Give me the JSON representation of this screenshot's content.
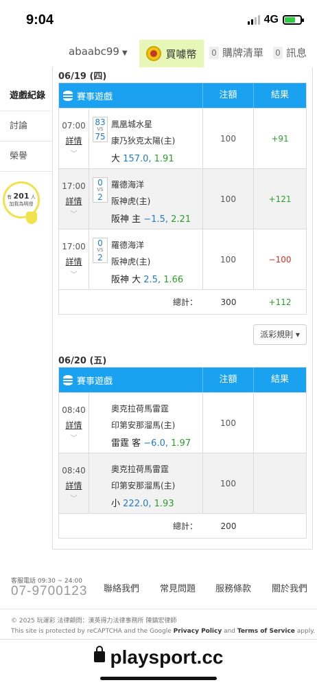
{
  "status_bar": {
    "time": "9:04",
    "network": "4G"
  },
  "nav": {
    "username": "abaabc99",
    "buy_coin": "買噱幣",
    "cart_count": "0",
    "cart_label": "購牌清單",
    "msg_count": "0",
    "msg_label": "訊息"
  },
  "sidebar": {
    "items": [
      {
        "label": "遊戲紀錄"
      },
      {
        "label": "討論"
      },
      {
        "label": "榮譽"
      }
    ],
    "help": {
      "prefix": "有",
      "count": "201",
      "suffix": "人",
      "caption": "加我為明燈"
    }
  },
  "headers": {
    "game": "賽事遊戲",
    "bet": "注額",
    "result": "結果"
  },
  "day1": {
    "date": "06/19 (四)",
    "rows": [
      {
        "time": "07:00",
        "detail": "詳情",
        "score_away": "83",
        "vs": "VS",
        "score_home": "75",
        "away": "鳳凰城水星",
        "home": "康乃狄克太陽(主)",
        "pick_text": "大",
        "pick_line": "157.0",
        "pick_sep": ",",
        "pick_odds": "1.91",
        "bet": "100",
        "result": "+91",
        "result_type": "win"
      },
      {
        "time": "17:00",
        "detail": "詳情",
        "score_away": "0",
        "vs": "VS",
        "score_home": "2",
        "away": "羅德海洋",
        "home": "阪神虎(主)",
        "pick_text": "阪神 主",
        "pick_line": "−1.5",
        "pick_sep": ",",
        "pick_odds": "2.21",
        "bet": "100",
        "result": "+121",
        "result_type": "win"
      },
      {
        "time": "17:00",
        "detail": "詳情",
        "score_away": "0",
        "vs": "VS",
        "score_home": "2",
        "away": "羅德海洋",
        "home": "阪神虎(主)",
        "pick_text": "阪神 大",
        "pick_line": "2.5",
        "pick_sep": ",",
        "pick_odds": "1.66",
        "bet": "100",
        "result": "−100",
        "result_type": "lose"
      }
    ],
    "total_label": "總計：",
    "total_bet": "300",
    "total_result": "+112"
  },
  "rules_button": "派彩規則 ▾",
  "day2": {
    "date": "06/20 (五)",
    "rows": [
      {
        "time": "08:40",
        "detail": "詳情",
        "away": "奧克拉荷馬雷霆",
        "home": "印第安那溜馬(主)",
        "pick_text": "雷霆 客",
        "pick_line": "−6.0",
        "pick_sep": ",",
        "pick_odds": "1.97",
        "bet": "100",
        "result": ""
      },
      {
        "time": "08:40",
        "detail": "詳情",
        "away": "奧克拉荷馬雷霆",
        "home": "印第安那溜馬(主)",
        "pick_text": "小",
        "pick_line": "222.0",
        "pick_sep": ",",
        "pick_odds": "1.93",
        "bet": "100",
        "result": ""
      }
    ],
    "total_label": "總計：",
    "total_bet": "200",
    "total_result": ""
  },
  "footer": {
    "phone_label": "客服電話 09:30 ~ 24:00",
    "phone": "07-9700123",
    "links": [
      "聯絡我們",
      "常見問題",
      "服務條款",
      "關於我們"
    ],
    "copyright": "© 2025 玩運彩 法律顧問：漢英得力法律事務所 陳鎮宏律師",
    "recaptcha_pre": "This site is protected by reCAPTCHA and the Google ",
    "privacy": "Privacy Policy",
    "and": " and ",
    "terms": "Terms of Service",
    "apply": " apply."
  },
  "browser": {
    "url": "playsport.cc"
  },
  "colors": {
    "header_blue": "#1aa2f0",
    "win_green": "#2a9d2a",
    "lose_red": "#d93025",
    "coin_bg": "#e6f7b8"
  }
}
